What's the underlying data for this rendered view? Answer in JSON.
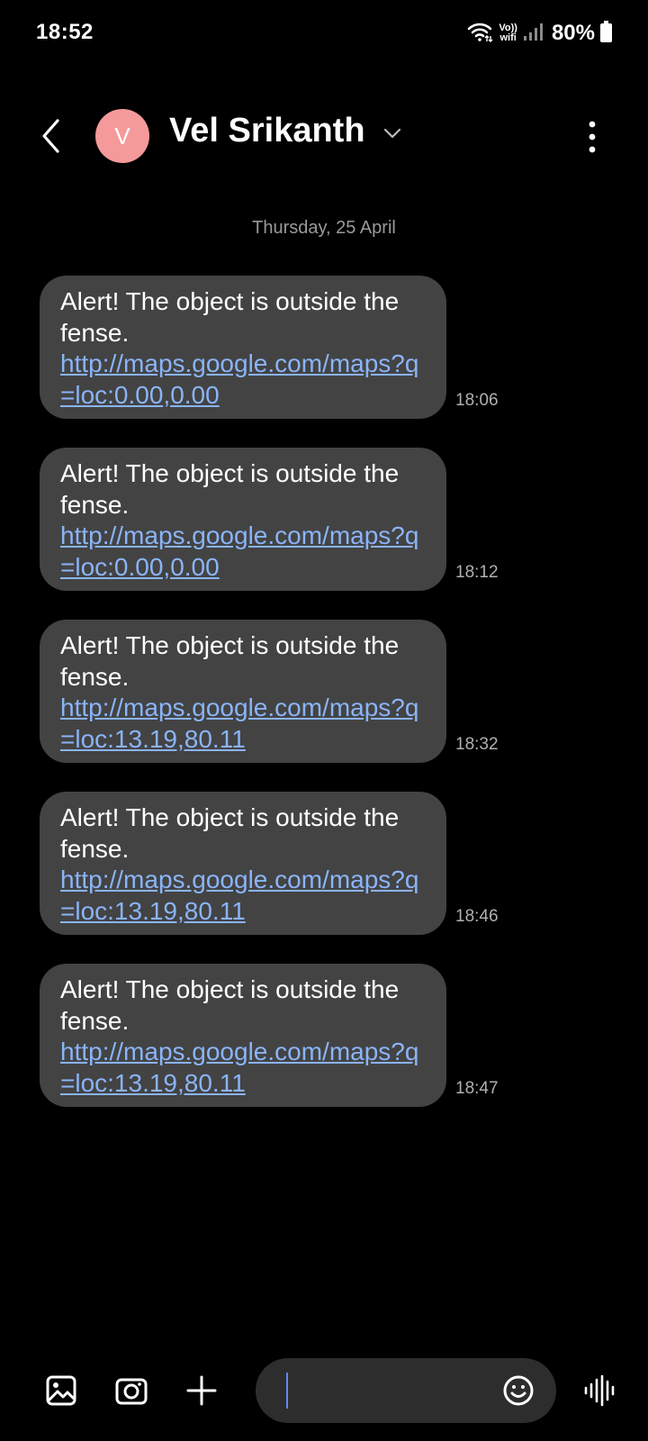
{
  "status_bar": {
    "time": "18:52",
    "vo_label": "Vo))",
    "wifi_label": "wifi",
    "battery": "80%"
  },
  "header": {
    "avatar_letter": "V",
    "contact_name": "Vel Srikanth"
  },
  "conversation": {
    "date": "Thursday, 25 April",
    "messages": [
      {
        "text": "Alert! The object is outside the fense.",
        "link": "http://maps.google.com/maps?q=loc:0.00,0.00",
        "time": "18:06"
      },
      {
        "text": "Alert! The object is outside the fense.",
        "link": "http://maps.google.com/maps?q=loc:0.00,0.00",
        "time": "18:12"
      },
      {
        "text": "Alert! The object is outside the fense.",
        "link": "http://maps.google.com/maps?q=loc:13.19,80.11",
        "time": "18:32"
      },
      {
        "text": "Alert! The object is outside the fense.",
        "link": "http://maps.google.com/maps?q=loc:13.19,80.11",
        "time": "18:46"
      },
      {
        "text": "Alert! The object is outside the fense.",
        "link": "http://maps.google.com/maps?q=loc:13.19,80.11",
        "time": "18:47"
      }
    ]
  },
  "composer": {
    "input_value": "",
    "icons": [
      "gallery-icon",
      "camera-icon",
      "plus-icon",
      "emoji-icon",
      "voice-icon"
    ]
  },
  "colors": {
    "background": "#000000",
    "bubble": "#434343",
    "link": "#8ab4f8",
    "avatar": "#f59a9a",
    "input_field": "#2d2d2d"
  }
}
